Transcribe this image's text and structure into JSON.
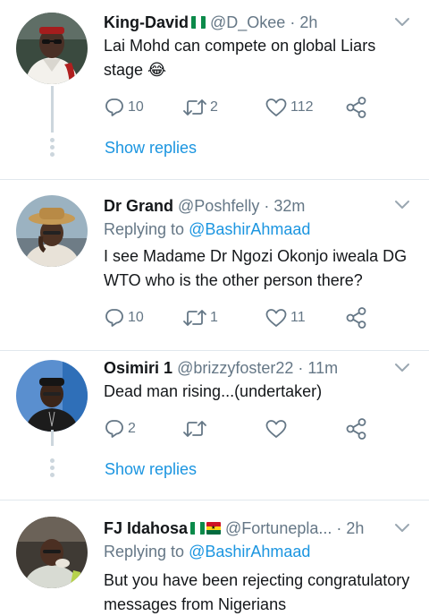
{
  "tweets": [
    {
      "name": "King-David",
      "handle": "@D_Okee",
      "separator": "·",
      "time": "2h",
      "text": "Lai Mohd can compete on global Liars stage 😂",
      "replies": "10",
      "retweets": "2",
      "likes": "112",
      "show_replies": "Show replies"
    },
    {
      "name": "Dr Grand",
      "handle": "@Poshfelly",
      "separator": "·",
      "time": "32m",
      "replying_prefix": "Replying to",
      "replying_to": "@BashirAhmaad",
      "text": "I see Madame Dr Ngozi Okonjo iweala DG WTO who is the other person there?",
      "replies": "10",
      "retweets": "1",
      "likes": "11"
    },
    {
      "name": "Osimiri 1",
      "handle": "@brizzyfoster22",
      "separator": "·",
      "time": "11m",
      "text": "Dead man rising...(undertaker)",
      "replies": "2",
      "retweets": "",
      "likes": "",
      "show_replies": "Show replies"
    },
    {
      "name": "FJ Idahosa",
      "handle": "@Fortunepla...",
      "separator": "·",
      "time": "2h",
      "replying_prefix": "Replying to",
      "replying_to": "@BashirAhmaad",
      "text": "But you have been rejecting congratulatory messages from Nigerians"
    }
  ],
  "icons": {
    "reply": "reply-icon",
    "retweet": "retweet-icon",
    "like": "heart-icon",
    "share": "share-icon",
    "menu": "chevron-down-icon"
  },
  "colors": {
    "link": "#1b95e0",
    "muted": "#657786",
    "divider": "#e1e8ed",
    "thread": "#ccd6dd"
  }
}
